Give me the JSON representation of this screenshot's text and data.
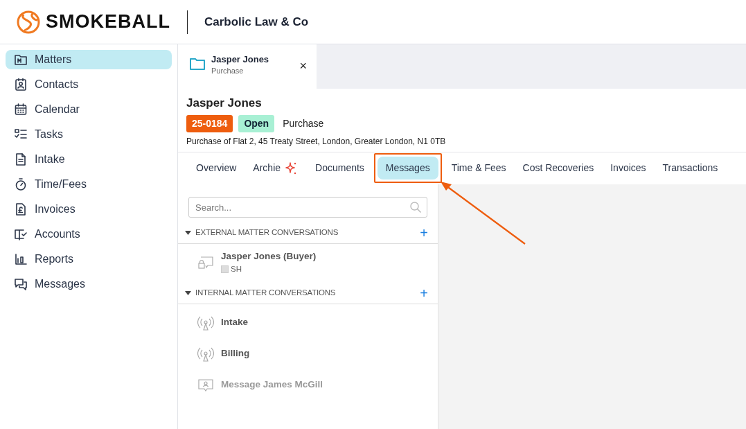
{
  "header": {
    "brand": "SMOKEBALL",
    "firm": "Carbolic Law & Co"
  },
  "sidebar": {
    "items": [
      {
        "label": "Matters",
        "selected": true
      },
      {
        "label": "Contacts",
        "selected": false
      },
      {
        "label": "Calendar",
        "selected": false
      },
      {
        "label": "Tasks",
        "selected": false
      },
      {
        "label": "Intake",
        "selected": false
      },
      {
        "label": "Time/Fees",
        "selected": false
      },
      {
        "label": "Invoices",
        "selected": false
      },
      {
        "label": "Accounts",
        "selected": false
      },
      {
        "label": "Reports",
        "selected": false
      },
      {
        "label": "Messages",
        "selected": false
      }
    ]
  },
  "matter_tab": {
    "title": "Jasper Jones",
    "subtitle": "Purchase",
    "close": "×"
  },
  "matter": {
    "name": "Jasper Jones",
    "number": "25-0184",
    "status": "Open",
    "type": "Purchase",
    "description": "Purchase of Flat 2, 45 Treaty Street, London, Greater London, N1 0TB"
  },
  "tabs": [
    {
      "label": "Overview",
      "selected": false,
      "sparkle": false,
      "annotated": false
    },
    {
      "label": "Archie",
      "selected": false,
      "sparkle": true,
      "annotated": false
    },
    {
      "label": "Documents",
      "selected": false,
      "sparkle": false,
      "annotated": false
    },
    {
      "label": "Messages",
      "selected": true,
      "sparkle": false,
      "annotated": true
    },
    {
      "label": "Time & Fees",
      "selected": false,
      "sparkle": false,
      "annotated": false
    },
    {
      "label": "Cost Recoveries",
      "selected": false,
      "sparkle": false,
      "annotated": false
    },
    {
      "label": "Invoices",
      "selected": false,
      "sparkle": false,
      "annotated": false
    },
    {
      "label": "Transactions",
      "selected": false,
      "sparkle": false,
      "annotated": false
    }
  ],
  "conversations": {
    "search": {
      "placeholder": "Search..."
    },
    "sections": [
      {
        "title": "EXTERNAL MATTER CONVERSATIONS",
        "add": "+",
        "expanded": true,
        "items": [
          {
            "kind": "external",
            "name": "Jasper Jones (Buyer)",
            "participants": [
              "SH"
            ]
          }
        ]
      },
      {
        "title": "INTERNAL MATTER CONVERSATIONS",
        "add": "+",
        "expanded": true,
        "items": [
          {
            "kind": "channel",
            "name": "Intake"
          },
          {
            "kind": "channel",
            "name": "Billing"
          },
          {
            "kind": "direct",
            "name": "Message James McGill"
          }
        ]
      }
    ]
  }
}
